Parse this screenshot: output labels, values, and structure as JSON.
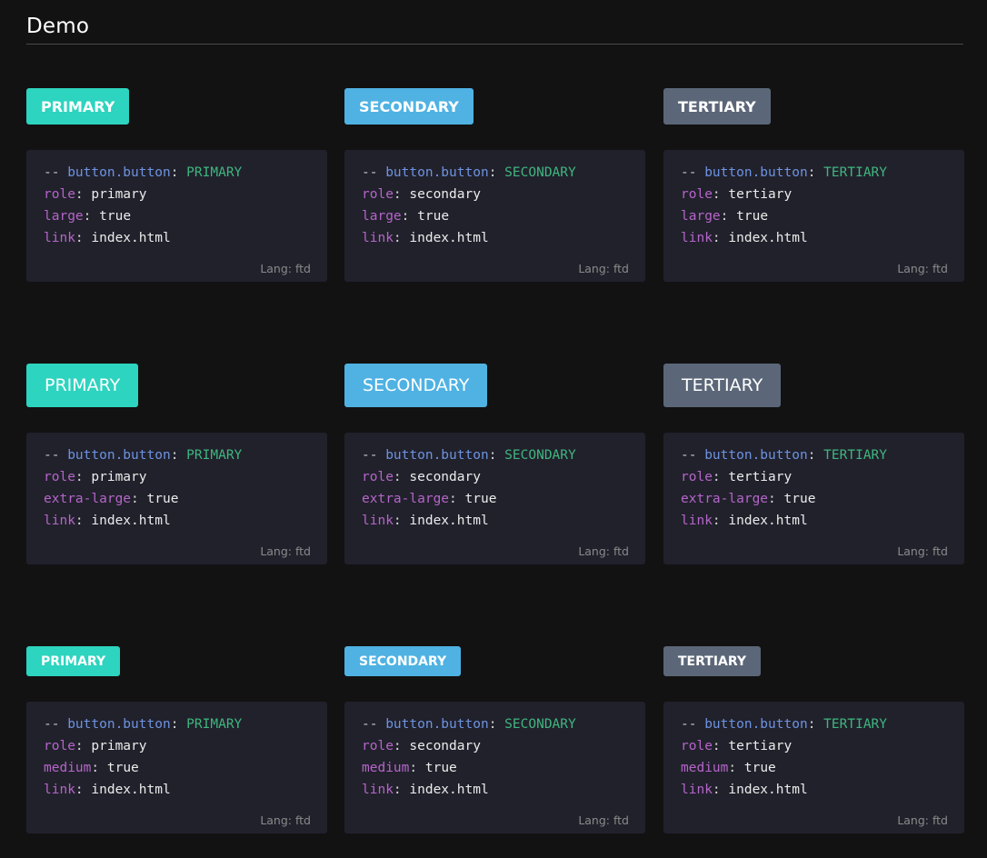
{
  "page": {
    "title": "Demo"
  },
  "colors": {
    "primary": "#2dd4bf",
    "secondary": "#4fb2e3",
    "tertiary": "#5b6778",
    "background": "#121212",
    "code_bg": "#21212c"
  },
  "code_syntax": {
    "comment_prefix": "-- ",
    "component": "button.button",
    "separator": ": ",
    "role_key": "role",
    "link_key": "link",
    "link_value": "index.html",
    "flag_value": "true"
  },
  "lang_label": "Lang: ftd",
  "rows": [
    {
      "size_key": "large",
      "items": [
        {
          "label": "PRIMARY",
          "role": "primary"
        },
        {
          "label": "SECONDARY",
          "role": "secondary"
        },
        {
          "label": "TERTIARY",
          "role": "tertiary"
        }
      ]
    },
    {
      "size_key": "extra-large",
      "items": [
        {
          "label": "PRIMARY",
          "role": "primary"
        },
        {
          "label": "SECONDARY",
          "role": "secondary"
        },
        {
          "label": "TERTIARY",
          "role": "tertiary"
        }
      ]
    },
    {
      "size_key": "medium",
      "items": [
        {
          "label": "PRIMARY",
          "role": "primary"
        },
        {
          "label": "SECONDARY",
          "role": "secondary"
        },
        {
          "label": "TERTIARY",
          "role": "tertiary"
        }
      ]
    }
  ]
}
